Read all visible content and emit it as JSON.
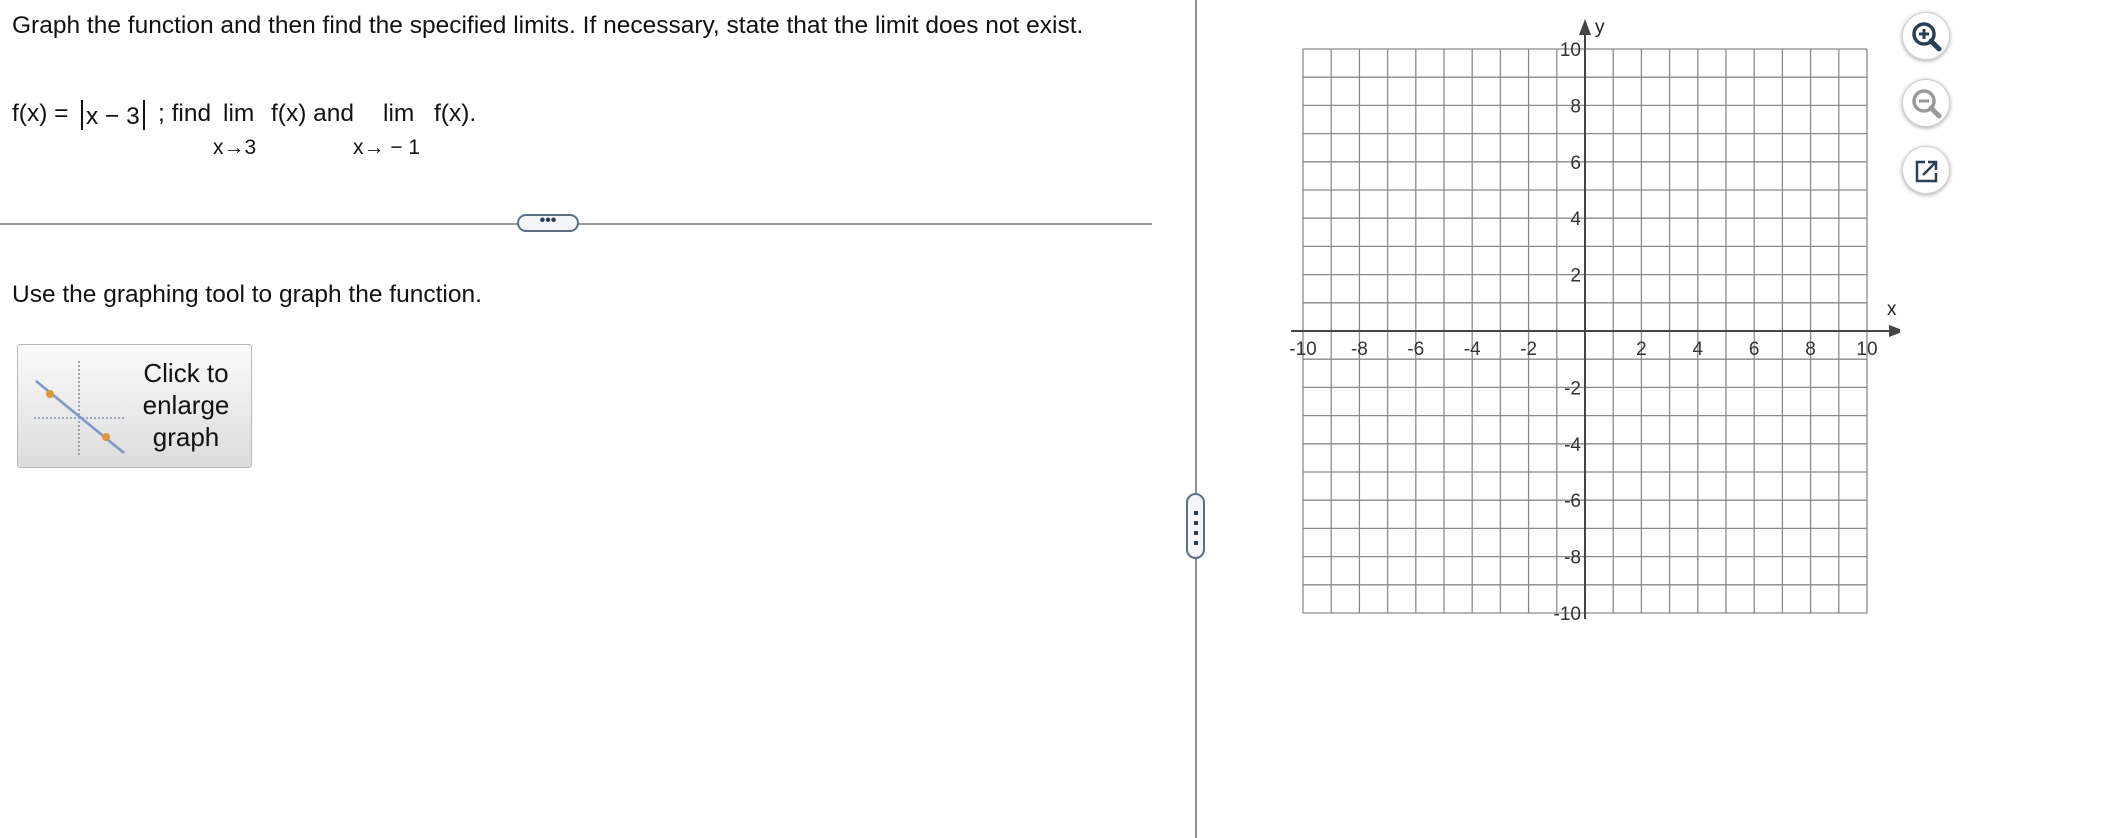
{
  "question": {
    "text": "Graph the function and then find the specified limits. If necessary, state that the limit does not exist.",
    "function_lhs": "f(x) =",
    "abs_inner": "x − 3",
    "find_text": "; find",
    "lim1_word": "lim",
    "lim1_expr": "f(x) and",
    "lim1_sub": "x→3",
    "lim2_word": "lim",
    "lim2_expr": "f(x).",
    "lim2_sub": "x→ − 1"
  },
  "divider": {
    "toggle_label": "•••"
  },
  "instruction": "Use the graphing tool to graph the function.",
  "enlarge_button": {
    "line1": "Click to",
    "line2": "enlarge",
    "line3": "graph"
  },
  "graph": {
    "x_axis_label": "x",
    "y_axis_label": "y",
    "x_range": [
      -10,
      10
    ],
    "y_range": [
      -10,
      10
    ],
    "grid_step": 1,
    "x_tick_labels": [
      "-10",
      "-8",
      "-6",
      "-4",
      "-2",
      "2",
      "4",
      "6",
      "8",
      "10"
    ],
    "y_tick_labels": [
      "10",
      "8",
      "6",
      "4",
      "2",
      "-2",
      "-4",
      "-6",
      "-8",
      "-10"
    ],
    "grid_color": "#8a8a8a",
    "axis_color": "#444444"
  },
  "toolbar": {
    "zoom_in_icon": "zoom-in-icon",
    "zoom_out_icon": "zoom-out-icon",
    "popout_icon": "popout-icon"
  }
}
